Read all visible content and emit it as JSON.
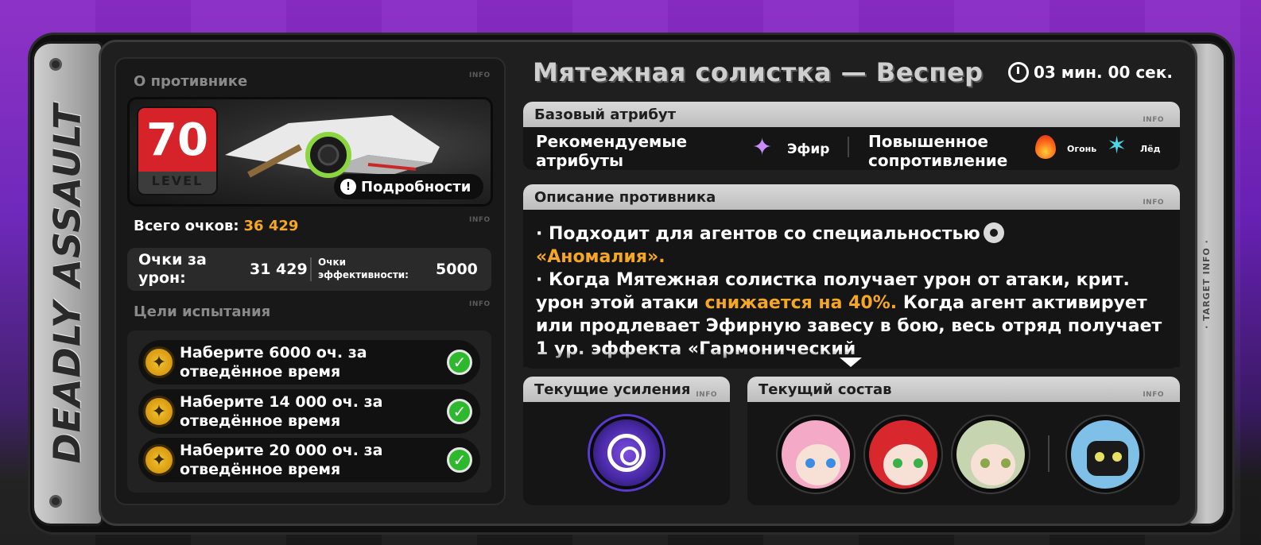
{
  "side_title": "DEADLY ASSAULT",
  "side_right_label": "· TARGET INFO ·",
  "info_tag": "INFO",
  "left": {
    "about_label": "О противнике",
    "level_number": "70",
    "level_word": "LEVEL",
    "details_button": "Подробности",
    "total_label": "Всего очков:",
    "total_value": "36 429",
    "damage_label": "Очки за урон:",
    "damage_value": "31 429",
    "efficiency_label": "Очки эффективности:",
    "efficiency_value": "5000",
    "goals_label": "Цели испытания",
    "goals": [
      {
        "text": "Наберите 6000 оч. за отведённое время",
        "done": true
      },
      {
        "text": "Наберите 14 000 оч. за отведённое время",
        "done": true
      },
      {
        "text": "Наберите 20 000 оч. за отведённое время",
        "done": true
      }
    ]
  },
  "header": {
    "enemy_name": "Мятежная солистка — Веспер",
    "timer": "03 мин. 00 сек."
  },
  "attributes": {
    "title": "Базовый атрибут",
    "recommended_label": "Рекомендуемые атрибуты",
    "recommended": [
      {
        "name": "Эфир",
        "icon": "ether-icon",
        "color": "#c98cff"
      }
    ],
    "resistant_label": "Повышенное сопротивление",
    "resistant": [
      {
        "name": "Огонь",
        "icon": "fire-icon",
        "color": "#ff6a1a"
      },
      {
        "name": "Лёд",
        "icon": "ice-icon",
        "color": "#4ad6e6"
      }
    ]
  },
  "description": {
    "title": "Описание противника",
    "line1_pre": "· Подходит для агентов со специальностью",
    "line1_hl": "«Аномалия».",
    "line2_pre": "· Когда Мятежная солистка получает урон от атаки, крит. урон этой атаки",
    "line2_hl": "снижается на 40%.",
    "line2_post": "Когда агент активирует или продлевает Эфирную завесу в бою, весь отряд получает 1 ур. эффекта «Гармонический"
  },
  "buffs": {
    "title": "Текущие усиления"
  },
  "team": {
    "title": "Текущий состав"
  },
  "colors": {
    "accent_orange": "#f5a623",
    "level_red": "#d6232a",
    "check_green": "#2db82d"
  }
}
